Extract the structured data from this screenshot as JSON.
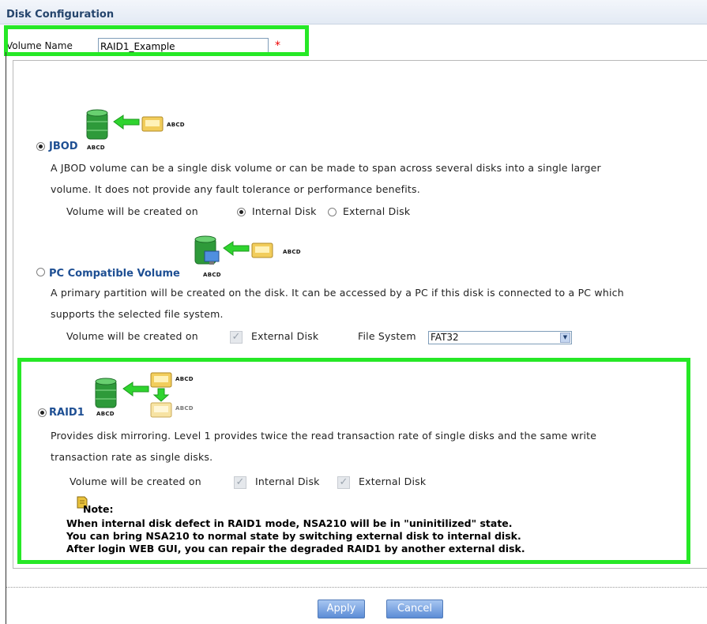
{
  "header": {
    "title": "Disk Configuration"
  },
  "volume_name": {
    "label": "Volume Name",
    "value": "RAID1_Example",
    "required_mark": "*"
  },
  "options": {
    "jbod": {
      "title": "JBOD",
      "disk_label": "ABCD",
      "target_label": "ABCD",
      "selected": true,
      "description_line1": "A JBOD volume can be a single disk volume or can be made to span across several disks into a single larger",
      "description_line2": "volume. It does not provide any fault tolerance or performance benefits.",
      "created_on_label": "Volume will be created on",
      "internal_label": "Internal Disk",
      "external_label": "External Disk",
      "internal_selected": true
    },
    "pc": {
      "title": "PC Compatible Volume",
      "disk_label": "ABCD",
      "target_label": "ABCD",
      "selected": false,
      "description_line1": "A primary partition will be created on the disk. It can be accessed by a PC if this disk is connected to a PC which",
      "description_line2": "supports the selected file system.",
      "created_on_label": "Volume will be created on",
      "external_label": "External Disk",
      "filesystem_label": "File System",
      "filesystem_value": "FAT32"
    },
    "raid1": {
      "title": "RAID1",
      "disk_label": "ABCD",
      "target_label_1": "ABCD",
      "target_label_2": "ABCD",
      "selected": true,
      "description_line1": "Provides disk mirroring. Level 1 provides twice the read transaction rate of single disks and the same write",
      "description_line2": "transaction rate as single disks.",
      "created_on_label": "Volume will be created on",
      "internal_label": "Internal Disk",
      "external_label": "External Disk",
      "note_title": "Note:",
      "note_line1": "When internal disk defect in RAID1 mode, NSA210 will be in \"uninitilized\" state.",
      "note_line2": "You can bring NSA210 to normal state by switching external disk to internal disk.",
      "note_line3": "After login WEB GUI, you can repair the degraded RAID1 by another external disk."
    }
  },
  "buttons": {
    "apply": "Apply",
    "cancel": "Cancel"
  },
  "colors": {
    "highlight": "#26e826",
    "title_blue": "#1e4f93",
    "button_blue": "#5c8cd6"
  },
  "icons": [
    "disk-stack-icon",
    "arrow-left-icon",
    "external-disk-icon",
    "pc-monitor-icon",
    "note-icon",
    "arrow-down-icon"
  ]
}
